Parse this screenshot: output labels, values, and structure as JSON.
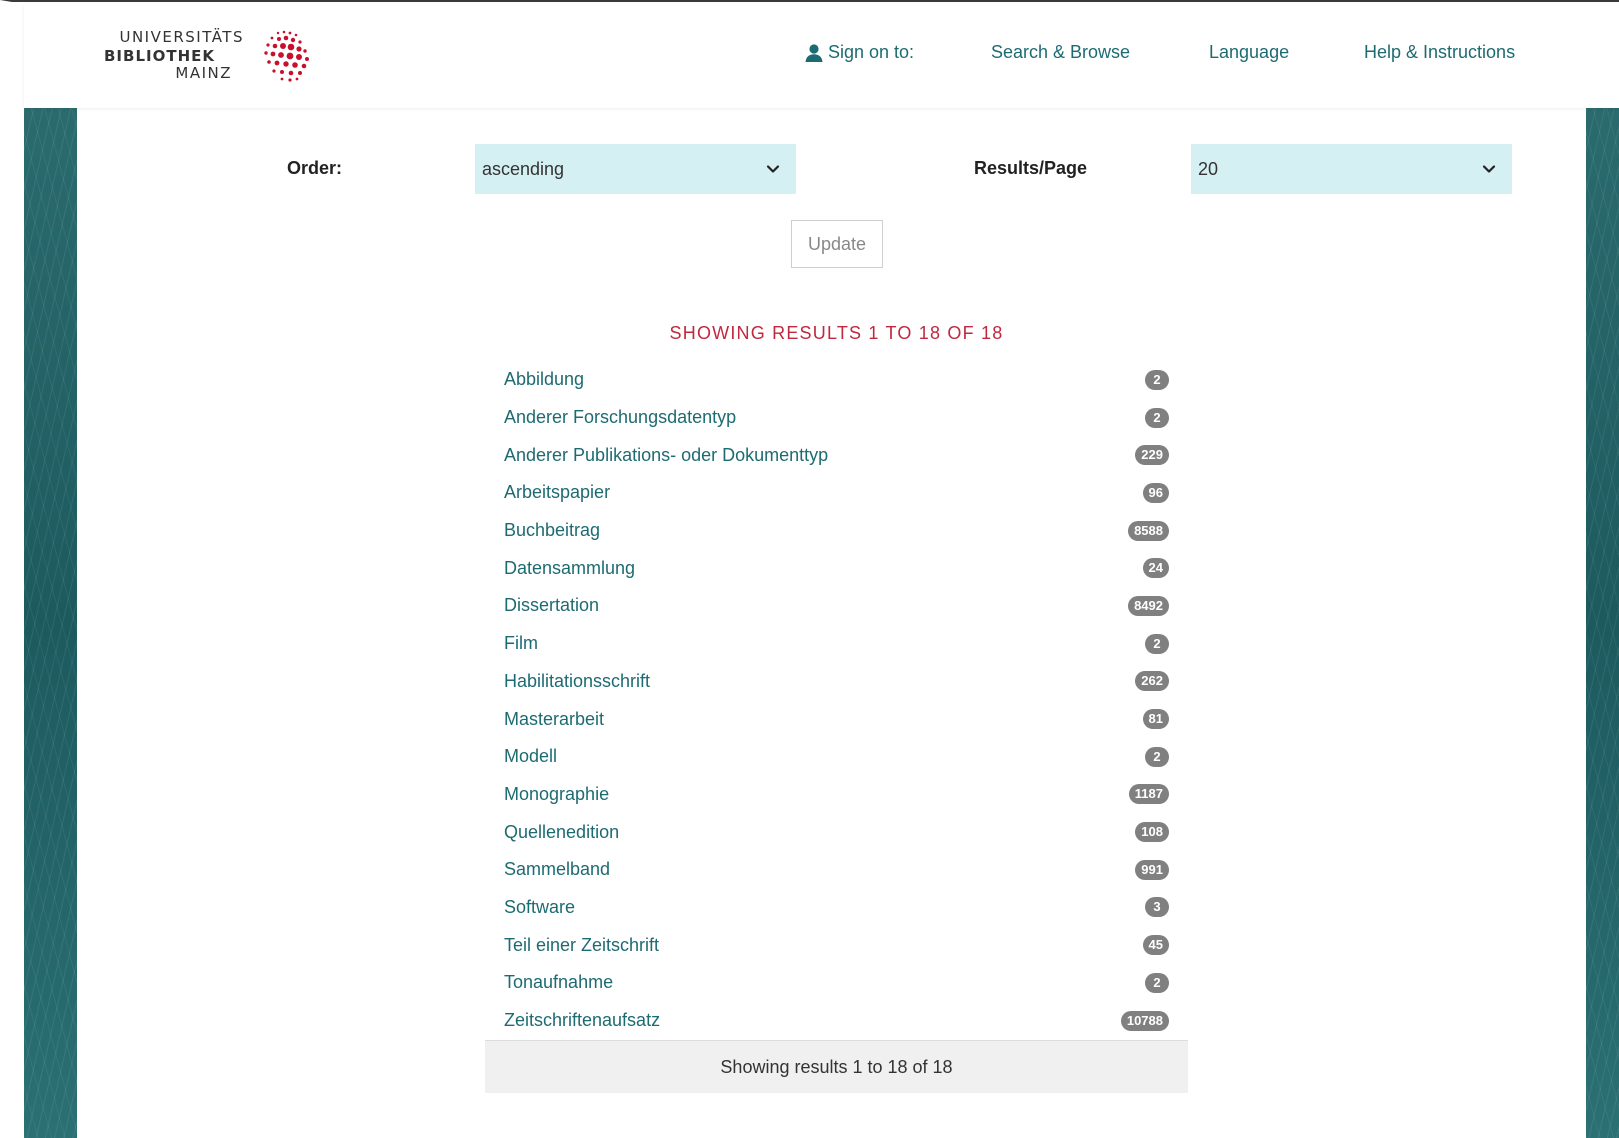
{
  "header": {
    "logo": {
      "line1": "UNIVERSITÄTS",
      "line2": "BIBLIOTHEK",
      "line3": "MAINZ"
    },
    "nav": {
      "sign_on": "Sign on to:",
      "search_browse": "Search & Browse",
      "language": "Language",
      "help": "Help & Instructions"
    }
  },
  "controls": {
    "order_label": "Order:",
    "order_value": "ascending",
    "rpp_label": "Results/Page",
    "rpp_value": "20",
    "update_label": "Update"
  },
  "results": {
    "heading": "SHOWING RESULTS 1 TO 18 OF 18",
    "footer": "Showing results 1 to 18 of 18",
    "items": [
      {
        "label": "Abbildung",
        "count": "2"
      },
      {
        "label": "Anderer Forschungsdatentyp",
        "count": "2"
      },
      {
        "label": "Anderer Publikations- oder Dokumenttyp",
        "count": "229"
      },
      {
        "label": "Arbeitspapier",
        "count": "96"
      },
      {
        "label": "Buchbeitrag",
        "count": "8588"
      },
      {
        "label": "Datensammlung",
        "count": "24"
      },
      {
        "label": "Dissertation",
        "count": "8492"
      },
      {
        "label": "Film",
        "count": "2"
      },
      {
        "label": "Habilitationsschrift",
        "count": "262"
      },
      {
        "label": "Masterarbeit",
        "count": "81"
      },
      {
        "label": "Modell",
        "count": "2"
      },
      {
        "label": "Monographie",
        "count": "1187"
      },
      {
        "label": "Quellenedition",
        "count": "108"
      },
      {
        "label": "Sammelband",
        "count": "991"
      },
      {
        "label": "Software",
        "count": "3"
      },
      {
        "label": "Teil einer Zeitschrift",
        "count": "45"
      },
      {
        "label": "Tonaufnahme",
        "count": "2"
      },
      {
        "label": "Zeitschriftenaufsatz",
        "count": "10788"
      }
    ]
  },
  "colors": {
    "brand_teal": "#1d6b72",
    "heading_red": "#c0283f",
    "select_bg": "#d4f0f3",
    "badge_gray": "#808080",
    "logo_red": "#c8102e"
  }
}
